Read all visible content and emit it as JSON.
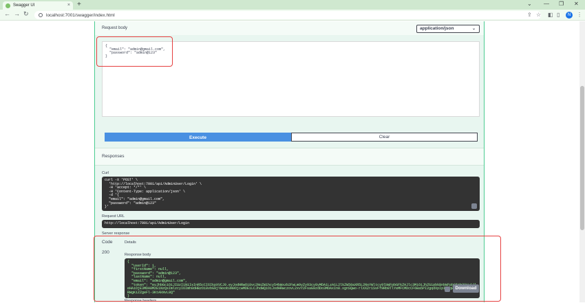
{
  "browser": {
    "tab_title": "Swagger UI",
    "tab_close": "×",
    "new_tab": "+",
    "url": "localhost:7001/swagger/index.html",
    "minimize": "—",
    "maximize": "❐",
    "close": "✕",
    "profile_initial": "N",
    "back": "←",
    "forward": "→",
    "reload": "↻"
  },
  "request": {
    "body_label": "Request body",
    "content_type": "application/json",
    "body_text": "{\n  \"email\": \"admin@gmail.com\",\n  \"password\": \"admin@123\"\n}",
    "execute_label": "Execute",
    "clear_label": "Clear"
  },
  "responses": {
    "title": "Responses",
    "curl_label": "Curl",
    "curl_text": "curl -X 'POST' \\\n  'http://localhost:7001/api/AdminUser/Login' \\\n  -H 'accept: */*' \\\n  -H 'Content-Type: application/json' \\\n  -d '{\n  \"email\": \"admin@gmail.com\",\n  \"password\": \"admin@123\"\n}'",
    "request_url_label": "Request URL",
    "request_url": "http://localhost:7001/api/AdminUser/Login",
    "server_response_label": "Server response",
    "code_header": "Code",
    "details_header": "Details",
    "code": "200",
    "response_body_label": "Response body",
    "response_body_text": "{\n  \"userId\": 1,\n  \"firstName\": null,\n  \"password\": \"admin@123\",\n  \"lastName\": null,\n  \"email\": \"admin@gmail.com\",\n  \"token\": \"eyJhbGciOiJIUzI1NiIsInR5cCI6IkpXVCJ9.eyJodHRwOi8vc2NoZW1hcy54bWxzb2FwLm9yZy93cy8yMDA1LzA1L2lkZW50aXR5L2NsYWltcy9lbWFpbGFkZHJlc3MiOiJhZG1pbkBnbWFpbC5jb20iLCJleHAiOjE3MDA0MzE1NzQsImlzcyI6Imh0dHBzOi8vbG9jYWxob3N0OjcwMDEiLCJhdWQiOiJodHRwczovL2xvY2FsaG9zdDo3MDAxIn0.xgnSQwo-rlXXZr1SvFf9Rb0TlYeMFCMDcCF6Ba5PI2gqdXpIpInDqB7q1Ta-ml4eERWgKiZZgeFl-3KtAkNvL8Q\"\n}",
    "download_label": "Download",
    "next_header": "Response headers"
  },
  "colors": {
    "accent_post": "#49cc90",
    "execute_blue": "#4990e2",
    "highlight_red": "#e53e3e",
    "code_bg": "#333333"
  }
}
